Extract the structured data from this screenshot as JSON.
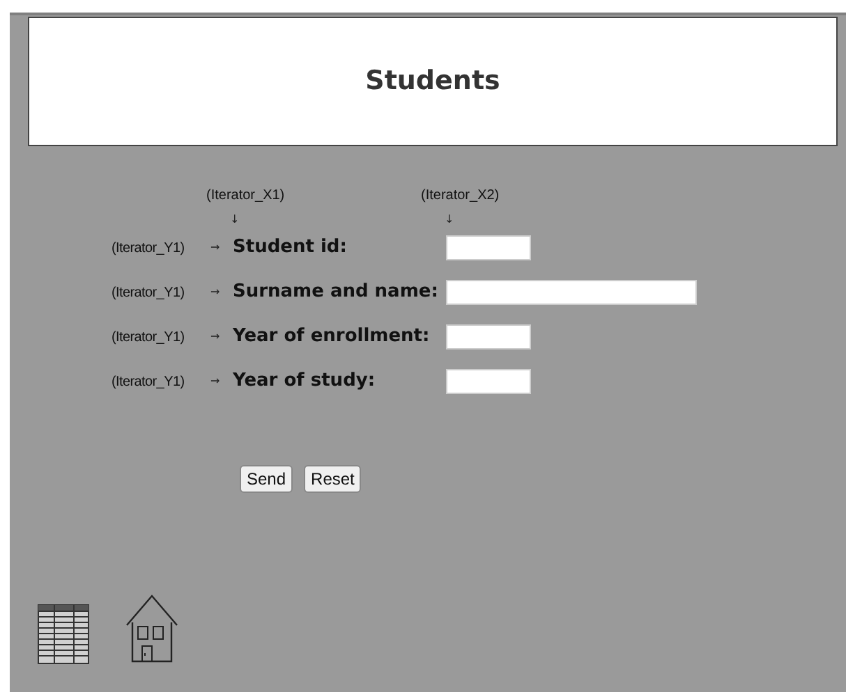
{
  "header": {
    "title": "Students"
  },
  "columns": [
    {
      "label": "(Iterator_X1)",
      "arrow": "↓"
    },
    {
      "label": "(Iterator_X2)",
      "arrow": "↓"
    }
  ],
  "rows": [
    {
      "iterator": "(Iterator_Y1)",
      "arrow": "→",
      "label": "Student id:",
      "kind": "short"
    },
    {
      "iterator": "(Iterator_Y1)",
      "arrow": "→",
      "label": "Surname and name:",
      "kind": "long"
    },
    {
      "iterator": "(Iterator_Y1)",
      "arrow": "→",
      "label": "Year of enrollment:",
      "kind": "short"
    },
    {
      "iterator": "(Iterator_Y1)",
      "arrow": "→",
      "label": "Year of study:",
      "kind": "short"
    }
  ],
  "buttons": [
    "Send",
    "Reset"
  ]
}
